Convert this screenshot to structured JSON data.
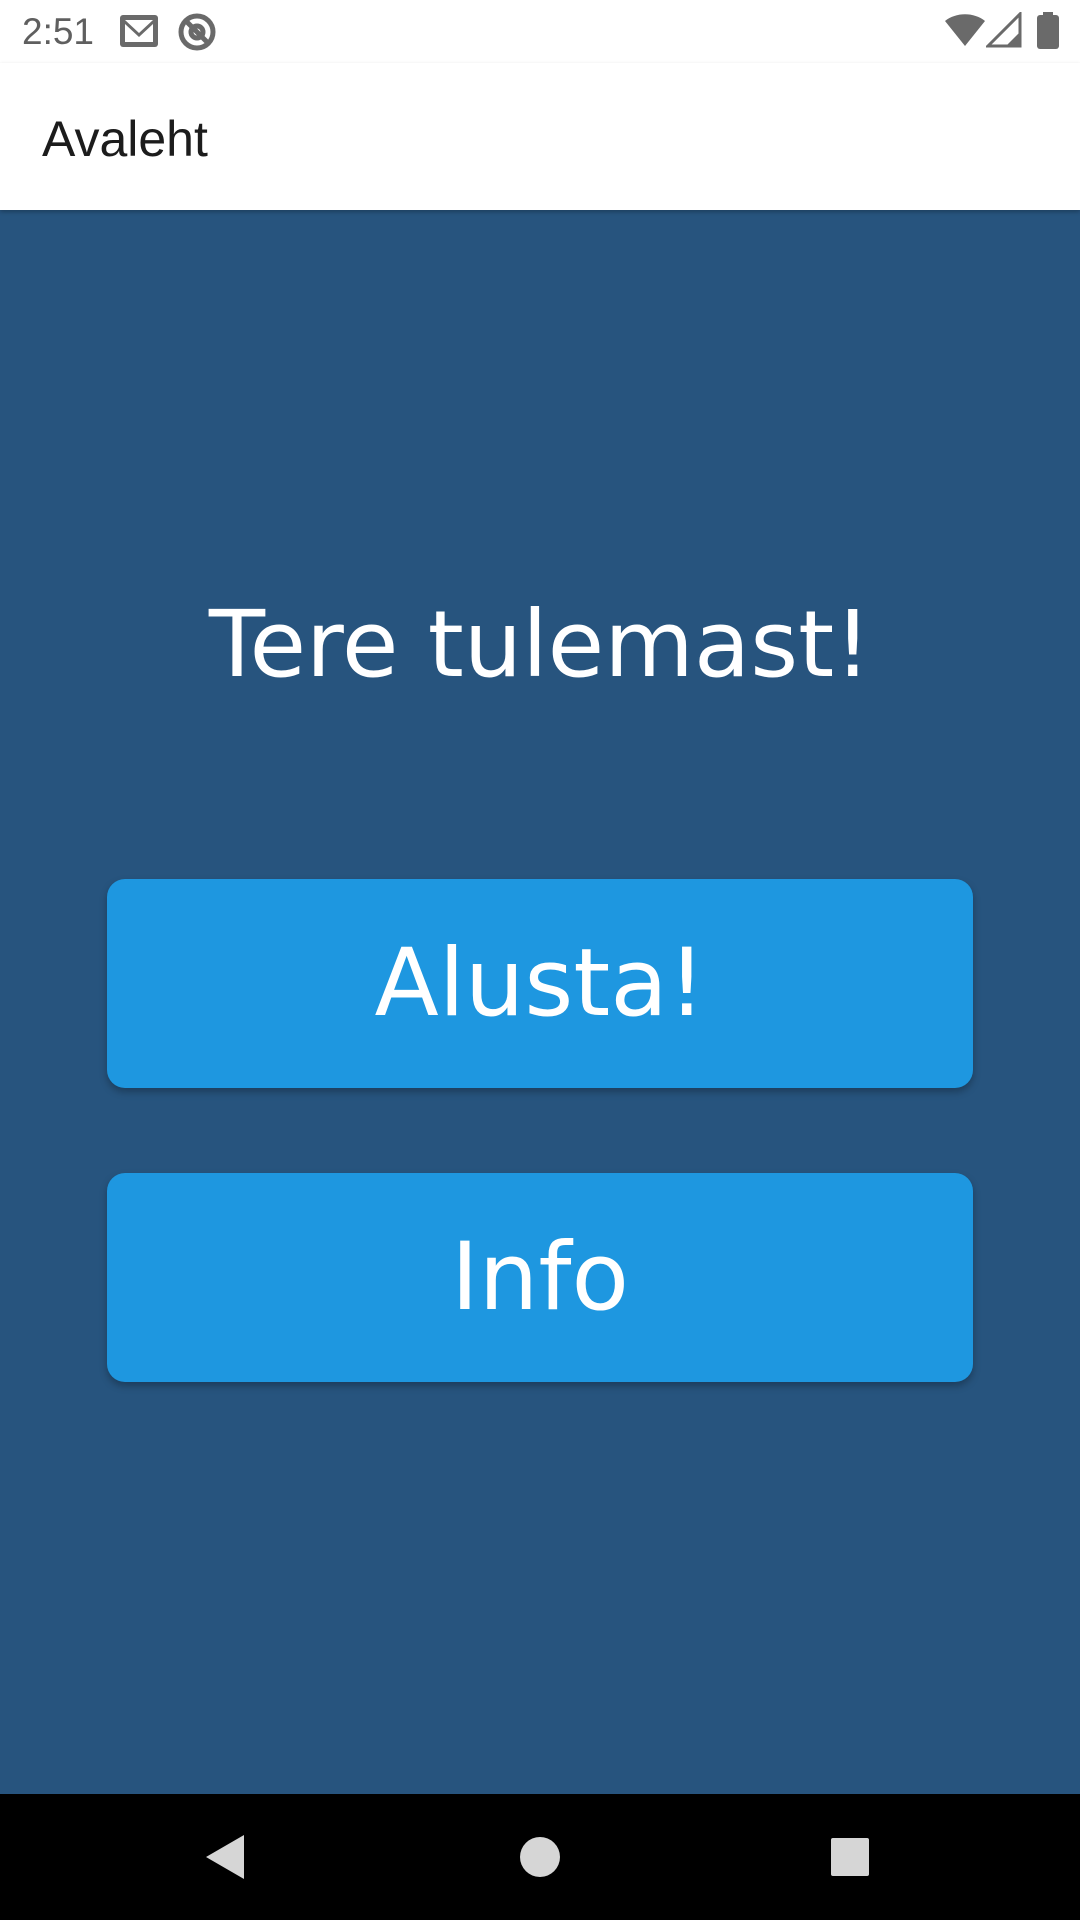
{
  "status_bar": {
    "time": "2:51",
    "left_icons": [
      "gmail-icon",
      "at-sign-icon"
    ],
    "right_icons": [
      "wifi-icon",
      "signal-icon",
      "battery-icon"
    ]
  },
  "app_bar": {
    "title": "Avaleht"
  },
  "main": {
    "welcome_text": "Tere tulemast!",
    "start_button_label": "Alusta!",
    "info_button_label": "Info"
  },
  "nav_bar": {
    "icons": [
      "back-icon",
      "home-icon",
      "recents-icon"
    ]
  },
  "colors": {
    "background": "#27547e",
    "button": "#1e97e0",
    "text_on_dark": "#ffffff"
  }
}
